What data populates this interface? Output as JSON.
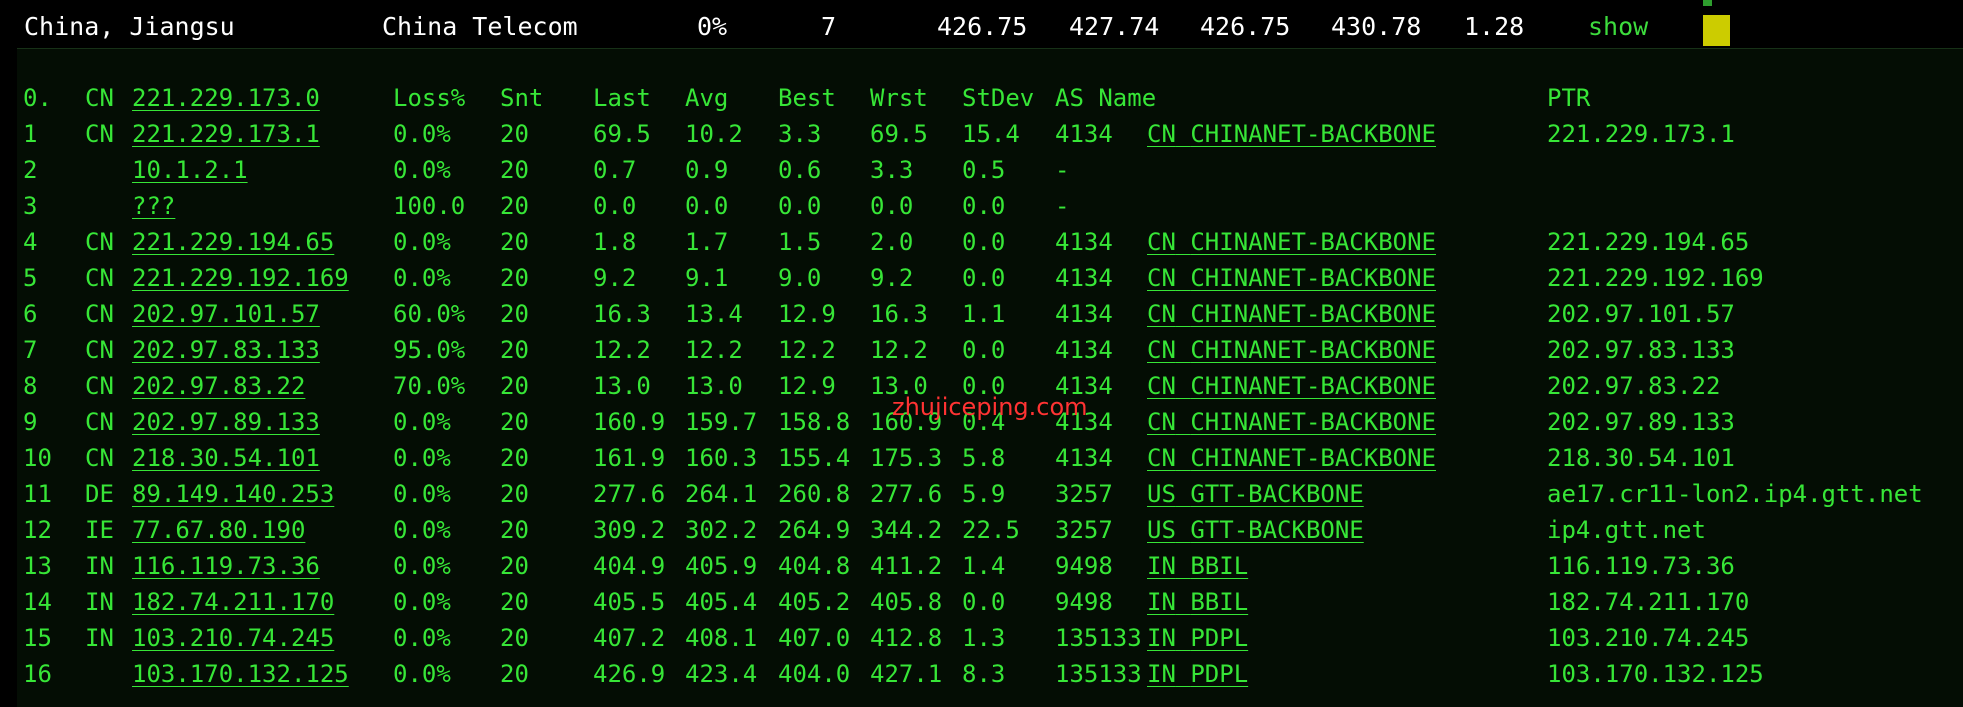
{
  "summary": {
    "location": "China, Jiangsu",
    "isp": "China Telecom",
    "loss": "0%",
    "sent": "7",
    "last": "426.75",
    "avg": "427.74",
    "best": "426.75",
    "worst": "430.78",
    "stdev": "1.28",
    "action": "show"
  },
  "header": {
    "hop": "0.",
    "cc": "CN",
    "host": "221.229.173.0",
    "loss": "Loss%",
    "snt": "Snt",
    "last": "Last",
    "avg": "Avg",
    "best": "Best",
    "wrst": "Wrst",
    "stdev": "StDev",
    "asname": "AS Name",
    "ptr": "PTR"
  },
  "hops": [
    {
      "hop": "1",
      "cc": "CN",
      "host": "221.229.173.1",
      "loss": "0.0%",
      "snt": "20",
      "last": "69.5",
      "avg": "10.2",
      "best": "3.3",
      "wrst": "69.5",
      "stdev": "15.4",
      "asn": "4134",
      "as_cc": "CN",
      "as_name": "CHINANET-BACKBONE",
      "ptr": "221.229.173.1"
    },
    {
      "hop": "2",
      "cc": "",
      "host": "10.1.2.1",
      "loss": "0.0%",
      "snt": "20",
      "last": "0.7",
      "avg": "0.9",
      "best": "0.6",
      "wrst": "3.3",
      "stdev": "0.5",
      "asn": "-",
      "as_cc": "",
      "as_name": "",
      "ptr": ""
    },
    {
      "hop": "3",
      "cc": "",
      "host": "???",
      "loss": "100.0",
      "snt": "20",
      "last": "0.0",
      "avg": "0.0",
      "best": "0.0",
      "wrst": "0.0",
      "stdev": "0.0",
      "asn": "-",
      "as_cc": "",
      "as_name": "",
      "ptr": ""
    },
    {
      "hop": "4",
      "cc": "CN",
      "host": "221.229.194.65",
      "loss": "0.0%",
      "snt": "20",
      "last": "1.8",
      "avg": "1.7",
      "best": "1.5",
      "wrst": "2.0",
      "stdev": "0.0",
      "asn": "4134",
      "as_cc": "CN",
      "as_name": "CHINANET-BACKBONE",
      "ptr": "221.229.194.65"
    },
    {
      "hop": "5",
      "cc": "CN",
      "host": "221.229.192.169",
      "loss": "0.0%",
      "snt": "20",
      "last": "9.2",
      "avg": "9.1",
      "best": "9.0",
      "wrst": "9.2",
      "stdev": "0.0",
      "asn": "4134",
      "as_cc": "CN",
      "as_name": "CHINANET-BACKBONE",
      "ptr": "221.229.192.169"
    },
    {
      "hop": "6",
      "cc": "CN",
      "host": "202.97.101.57",
      "loss": "60.0%",
      "snt": "20",
      "last": "16.3",
      "avg": "13.4",
      "best": "12.9",
      "wrst": "16.3",
      "stdev": "1.1",
      "asn": "4134",
      "as_cc": "CN",
      "as_name": "CHINANET-BACKBONE",
      "ptr": "202.97.101.57"
    },
    {
      "hop": "7",
      "cc": "CN",
      "host": "202.97.83.133",
      "loss": "95.0%",
      "snt": "20",
      "last": "12.2",
      "avg": "12.2",
      "best": "12.2",
      "wrst": "12.2",
      "stdev": "0.0",
      "asn": "4134",
      "as_cc": "CN",
      "as_name": "CHINANET-BACKBONE",
      "ptr": "202.97.83.133"
    },
    {
      "hop": "8",
      "cc": "CN",
      "host": "202.97.83.22",
      "loss": "70.0%",
      "snt": "20",
      "last": "13.0",
      "avg": "13.0",
      "best": "12.9",
      "wrst": "13.0",
      "stdev": "0.0",
      "asn": "4134",
      "as_cc": "CN",
      "as_name": "CHINANET-BACKBONE",
      "ptr": "202.97.83.22"
    },
    {
      "hop": "9",
      "cc": "CN",
      "host": "202.97.89.133",
      "loss": "0.0%",
      "snt": "20",
      "last": "160.9",
      "avg": "159.7",
      "best": "158.8",
      "wrst": "160.9",
      "stdev": "0.4",
      "asn": "4134",
      "as_cc": "CN",
      "as_name": "CHINANET-BACKBONE",
      "ptr": "202.97.89.133"
    },
    {
      "hop": "10",
      "cc": "CN",
      "host": "218.30.54.101",
      "loss": "0.0%",
      "snt": "20",
      "last": "161.9",
      "avg": "160.3",
      "best": "155.4",
      "wrst": "175.3",
      "stdev": "5.8",
      "asn": "4134",
      "as_cc": "CN",
      "as_name": "CHINANET-BACKBONE",
      "ptr": "218.30.54.101"
    },
    {
      "hop": "11",
      "cc": "DE",
      "host": "89.149.140.253",
      "loss": "0.0%",
      "snt": "20",
      "last": "277.6",
      "avg": "264.1",
      "best": "260.8",
      "wrst": "277.6",
      "stdev": "5.9",
      "asn": "3257",
      "as_cc": "US",
      "as_name": "GTT-BACKBONE",
      "ptr": "ae17.cr11-lon2.ip4.gtt.net"
    },
    {
      "hop": "12",
      "cc": "IE",
      "host": "77.67.80.190",
      "loss": "0.0%",
      "snt": "20",
      "last": "309.2",
      "avg": "302.2",
      "best": "264.9",
      "wrst": "344.2",
      "stdev": "22.5",
      "asn": "3257",
      "as_cc": "US",
      "as_name": "GTT-BACKBONE",
      "ptr": "ip4.gtt.net"
    },
    {
      "hop": "13",
      "cc": "IN",
      "host": "116.119.73.36",
      "loss": "0.0%",
      "snt": "20",
      "last": "404.9",
      "avg": "405.9",
      "best": "404.8",
      "wrst": "411.2",
      "stdev": "1.4",
      "asn": "9498",
      "as_cc": "IN",
      "as_name": "BBIL",
      "ptr": "116.119.73.36"
    },
    {
      "hop": "14",
      "cc": "IN",
      "host": "182.74.211.170",
      "loss": "0.0%",
      "snt": "20",
      "last": "405.5",
      "avg": "405.4",
      "best": "405.2",
      "wrst": "405.8",
      "stdev": "0.0",
      "asn": "9498",
      "as_cc": "IN",
      "as_name": "BBIL",
      "ptr": "182.74.211.170"
    },
    {
      "hop": "15",
      "cc": "IN",
      "host": "103.210.74.245",
      "loss": "0.0%",
      "snt": "20",
      "last": "407.2",
      "avg": "408.1",
      "best": "407.0",
      "wrst": "412.8",
      "stdev": "1.3",
      "asn": "135133",
      "as_cc": "IN",
      "as_name": "PDPL",
      "ptr": "103.210.74.245"
    },
    {
      "hop": "16",
      "cc": "",
      "host": "103.170.132.125",
      "loss": "0.0%",
      "snt": "20",
      "last": "426.9",
      "avg": "423.4",
      "best": "404.0",
      "wrst": "427.1",
      "stdev": "8.3",
      "asn": "135133",
      "as_cc": "IN",
      "as_name": "PDPL",
      "ptr": "103.170.132.125"
    }
  ],
  "watermark": "zhujiceping.com",
  "colors": {
    "terminal_bg": "#040d04",
    "terminal_fg": "#37e637",
    "watermark": "#ff3333",
    "highlight": "#cccc00"
  }
}
